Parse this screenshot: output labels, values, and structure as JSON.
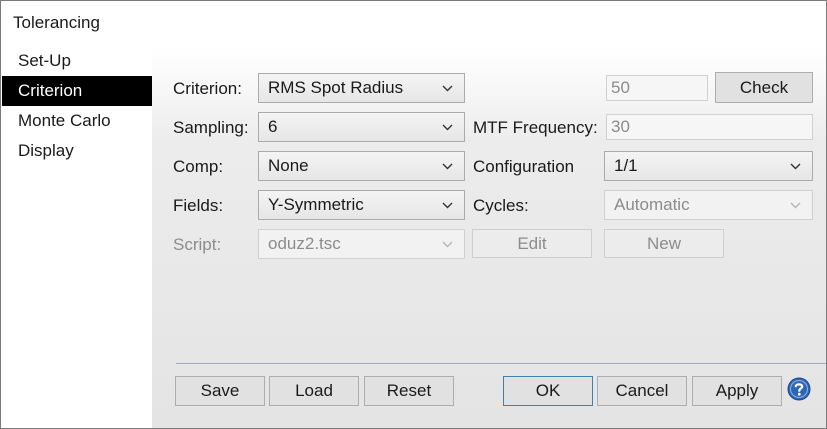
{
  "window": {
    "title": "Tolerancing"
  },
  "sidebar": {
    "items": [
      {
        "label": "Set-Up",
        "active": false
      },
      {
        "label": "Criterion",
        "active": true
      },
      {
        "label": "Monte Carlo",
        "active": false
      },
      {
        "label": "Display",
        "active": false
      }
    ]
  },
  "form": {
    "criterion": {
      "label": "Criterion:",
      "value": "RMS Spot Radius"
    },
    "criterion_value": {
      "value": "50",
      "enabled": false
    },
    "check_button": {
      "label": "Check"
    },
    "sampling": {
      "label": "Sampling:",
      "value": "6"
    },
    "mtf_frequency": {
      "label": "MTF Frequency:",
      "value": "30",
      "enabled": false
    },
    "comp": {
      "label": "Comp:",
      "value": "None"
    },
    "configuration": {
      "label": "Configuration",
      "value": "1/1"
    },
    "fields": {
      "label": "Fields:",
      "value": "Y-Symmetric"
    },
    "cycles": {
      "label": "Cycles:",
      "value": "Automatic",
      "enabled": false
    },
    "script": {
      "label": "Script:",
      "value": "oduz2.tsc",
      "enabled": false
    },
    "edit_button": {
      "label": "Edit",
      "enabled": false
    },
    "new_button": {
      "label": "New",
      "enabled": false
    }
  },
  "footer": {
    "save": "Save",
    "load": "Load",
    "reset": "Reset",
    "ok": "OK",
    "cancel": "Cancel",
    "apply": "Apply",
    "help_icon": "question-circle-icon"
  },
  "colors": {
    "selected_bg": "#000000",
    "selected_fg": "#ffffff",
    "default_button_border": "#3c7fb1",
    "help_icon_fill": "#2f66b3",
    "disabled_text": "#8c8c8c"
  }
}
